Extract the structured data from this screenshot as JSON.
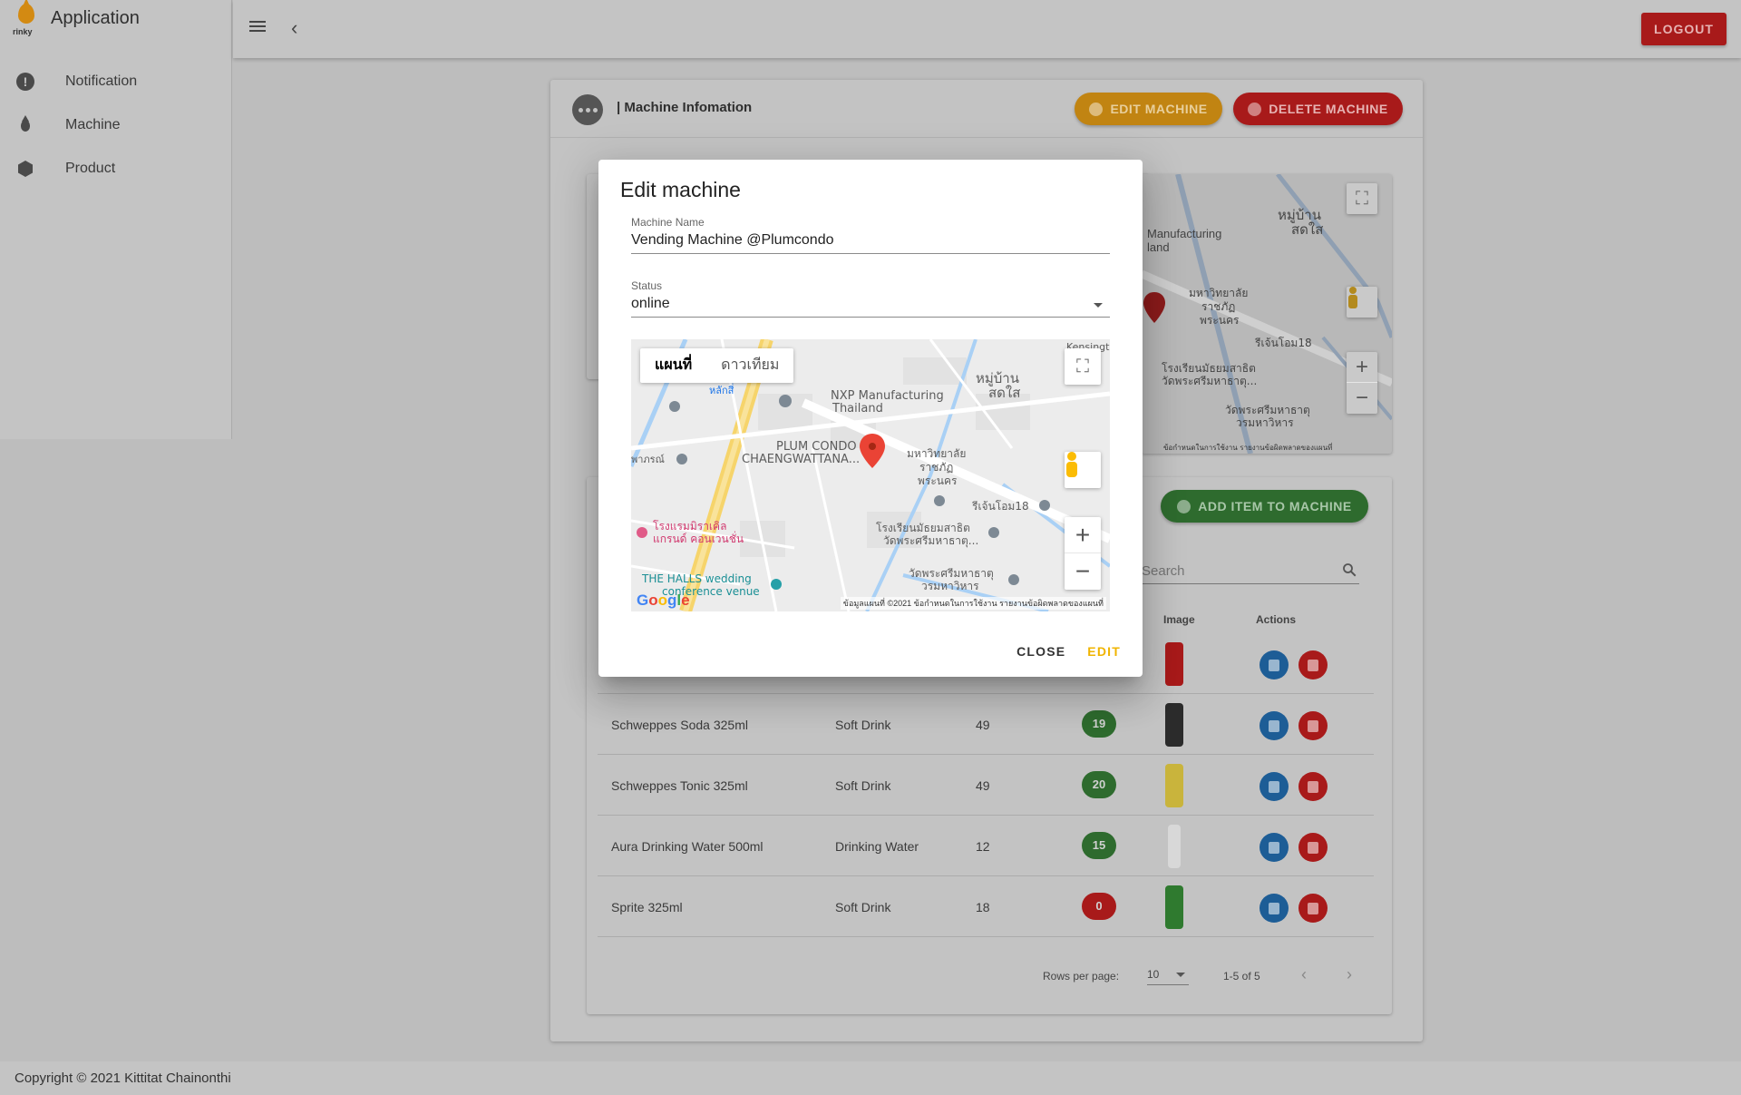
{
  "app": {
    "title": "Application",
    "logo_text": "rinky"
  },
  "sidebar": {
    "items": [
      {
        "label": "Notification",
        "icon": "alert-circle-icon"
      },
      {
        "label": "Machine",
        "icon": "water-drop-icon"
      },
      {
        "label": "Product",
        "icon": "box-icon"
      }
    ]
  },
  "topbar": {
    "logout_label": "LOGOUT"
  },
  "card": {
    "title": "| Machine Infomation",
    "edit_label": "EDIT MACHINE",
    "delete_label": "DELETE MACHINE",
    "add_item_label": "ADD ITEM TO MACHINE",
    "search_placeholder": "Search"
  },
  "table": {
    "headers": {
      "image": "Image",
      "actions": "Actions"
    },
    "rows": [
      {
        "name": "Schweppes Soda 325ml",
        "category": "Soft Drink",
        "price": "49",
        "qty": "19",
        "status": "green",
        "thumb_color": "#2b2b2b"
      },
      {
        "name": "Schweppes Tonic 325ml",
        "category": "Soft Drink",
        "price": "49",
        "qty": "20",
        "status": "green",
        "thumb_color": "#c9b43c"
      },
      {
        "name": "Aura Drinking Water 500ml",
        "category": "Drinking Water",
        "price": "12",
        "qty": "15",
        "status": "green",
        "thumb_color": "#d8d8d8"
      },
      {
        "name": "Sprite 325ml",
        "category": "Soft Drink",
        "price": "18",
        "qty": "0",
        "status": "red",
        "thumb_color": "#2f7a2f"
      }
    ],
    "rows_per_page_label": "Rows per page:",
    "rows_per_page": "10",
    "range": "1-5 of 5"
  },
  "dialog": {
    "title": "Edit machine",
    "name_label": "Machine Name",
    "name_value": "Vending Machine @Plumcondo",
    "status_label": "Status",
    "status_value": "online",
    "close_label": "CLOSE",
    "edit_label": "EDIT"
  },
  "map": {
    "tab_map": "แผนที่",
    "tab_satellite": "ดาวเทียม",
    "labels": {
      "nxp": "NXP Manufacturing",
      "nxp2": "Thailand",
      "plum": "PLUM CONDO",
      "plum2": "CHAENGWATTANA...",
      "uni": "มหาวิทยาลัย",
      "uni2": "ราชภัฏ",
      "uni3": "พระนคร",
      "village": "หมู่บ้าน",
      "village2": "สดใส",
      "soi": "รีเจ้นโอม18",
      "school": "โรงเรียนมัธยมสาธิต",
      "school2": "วัดพระศรีมหาธาตุ...",
      "temple": "วัดพระศรีมหาธาตุ",
      "temple2": "วรมหาวิหาร",
      "halls": "THE HALLS wedding",
      "halls2": "conference venue",
      "hotel": "โรงแรมมิราเคิล",
      "hotel2": "แกรนด์ คอนเวนชั่น",
      "kensington": "Kensingt",
      "road": "พาภรณ์",
      "laksi": "หลักสี่",
      "footer": "ข้อมูลแผนที่ ©2021   ข้อกำหนดในการใช้งาน   รายงานข้อผิดพลาดของแผนที่"
    },
    "bg_labels": {
      "nxp": "Manufacturing",
      "nxp2": "land",
      "village": "หมู่บ้าน",
      "village2": "สดใส",
      "uni": "มหาวิทยาลัย",
      "uni2": "ราชภัฏ",
      "uni3": "พระนคร",
      "soi": "รีเจ้นโอม18",
      "school": "โรงเรียนมัธยมสาธิต",
      "school2": "วัดพระศรีมหาธาตุ...",
      "temple": "วัดพระศรีมหาธาตุ",
      "temple2": "วรมหาวิหาร",
      "footer": "ข้อกำหนดในการใช้งาน   รายงานข้อผิดพลาดของแผนที่"
    }
  },
  "footer": {
    "copyright": "Copyright © 2021 Kittitat Chainonthi"
  },
  "colors": {
    "accent_orange": "#c18412",
    "danger": "#a81a1a",
    "success": "#2e6b2e",
    "primary": "#1d5d96",
    "edit_text": "#f0b400"
  }
}
